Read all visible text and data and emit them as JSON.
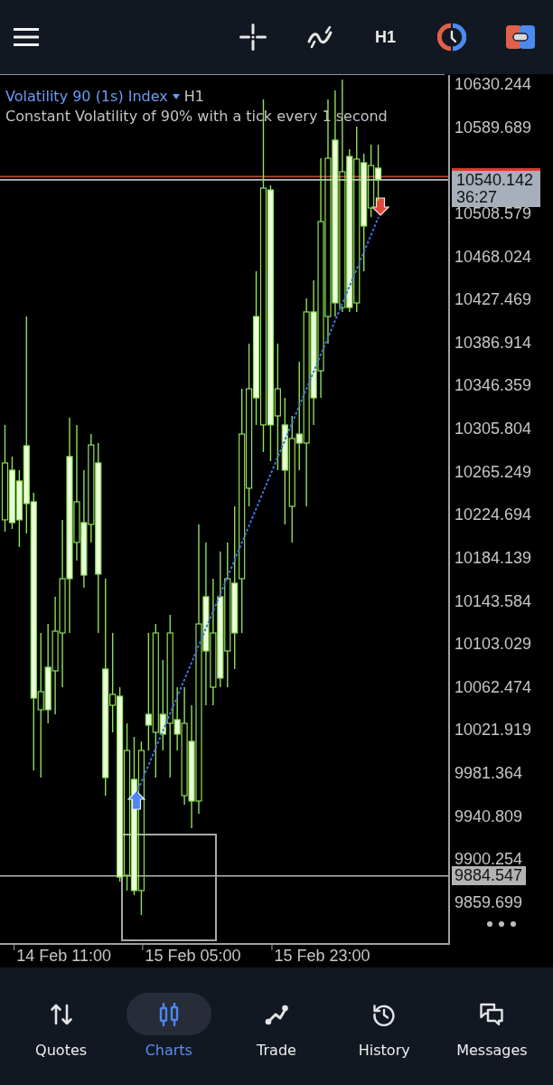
{
  "toolbar": {
    "timeframe": "H1"
  },
  "chart": {
    "symbol": "Volatility 90 (1s) Index",
    "timeframe": "H1",
    "description": "Constant Volatility of 90% with a tick every 1 second",
    "chart_data": {
      "type": "candlestick",
      "categories": [
        null,
        null,
        null,
        null,
        null,
        null,
        null,
        null,
        "14 Feb 11:00",
        null,
        null,
        null,
        null,
        null,
        null,
        null,
        null,
        null,
        null,
        null,
        null,
        null,
        null,
        null,
        null,
        null,
        "15 Feb 05:00",
        null,
        null,
        null,
        null,
        null,
        null,
        null,
        null,
        null,
        null,
        null,
        null,
        null,
        null,
        null,
        null,
        null,
        "15 Feb 23:00",
        null,
        null,
        null,
        null,
        null,
        null,
        null,
        null
      ],
      "ohlc": [
        [
          10219.9,
          10309.3,
          10208.8,
          10273.5
        ],
        [
          10266.7,
          10279.5,
          10211.3,
          10217.3
        ],
        [
          10256.5,
          10266.7,
          10194.3,
          10219.9
        ],
        [
          10289.7,
          10411.4,
          10207.1,
          10235.2
        ],
        [
          10236.9,
          10245.4,
          9984.0,
          10052.1
        ],
        [
          10041.1,
          10113.4,
          9977.2,
          10058.1
        ],
        [
          10081.1,
          10121.9,
          10028.3,
          10041.1
        ],
        [
          10077.7,
          10147.5,
          10036.8,
          10115.1
        ],
        [
          10113.4,
          10219.9,
          10062.3,
          10164.5
        ],
        [
          10279.5,
          10316.1,
          10113.4,
          10164.5
        ],
        [
          10198.6,
          10309.3,
          10181.5,
          10236.9
        ],
        [
          10217.3,
          10266.7,
          10156.0,
          10167.9
        ],
        [
          10215.6,
          10300.7,
          10198.6,
          10290.5
        ],
        [
          10273.5,
          10292.2,
          10113.4,
          10168.8
        ],
        [
          10079.4,
          10164.5,
          9960.2,
          9977.2
        ],
        [
          10045.3,
          10113.4,
          10019.8,
          10055.5
        ],
        [
          10053.8,
          10062.3,
          9879.3,
          9883.5
        ],
        [
          9885.2,
          10028.3,
          9870.8,
          10002.7
        ],
        [
          9975.5,
          10015.5,
          9866.5,
          9870.8
        ],
        [
          9870.8,
          10011.3,
          9847.8,
          10002.7
        ],
        [
          10036.8,
          10113.4,
          10002.7,
          10026.6
        ],
        [
          10019.8,
          10121.9,
          9977.2,
          10113.4
        ],
        [
          10036.8,
          10087.9,
          10002.7,
          10018.1
        ],
        [
          10028.3,
          10130.5,
          9977.2,
          10113.4
        ],
        [
          10031.7,
          10062.3,
          10002.7,
          10018.1
        ],
        [
          9960.2,
          10062.3,
          9951.7,
          10028.3
        ],
        [
          10011.3,
          10045.3,
          9929.5,
          9955.1
        ],
        [
          9955.1,
          10215.6,
          9943.1,
          10121.9
        ],
        [
          10147.5,
          10198.6,
          10045.3,
          10096.4
        ],
        [
          10062.3,
          10164.5,
          10045.3,
          10113.4
        ],
        [
          10147.5,
          10190.1,
          10062.3,
          10070.9
        ],
        [
          10096.4,
          10198.6,
          10062.3,
          10164.5
        ],
        [
          10160.3,
          10232.6,
          10079.4,
          10113.4
        ],
        [
          10164.5,
          10343.3,
          10113.4,
          10300.7
        ],
        [
          10249.7,
          10385.9,
          10232.6,
          10343.3
        ],
        [
          10411.4,
          10454.0,
          10309.3,
          10334.8
        ],
        [
          10309.3,
          10615.8,
          10283.7,
          10532.3
        ],
        [
          10530.6,
          10534.9,
          10275.2,
          10309.3
        ],
        [
          10317.8,
          10385.9,
          10266.7,
          10343.3
        ],
        [
          10309.3,
          10334.8,
          10215.6,
          10266.7
        ],
        [
          10232.6,
          10317.8,
          10198.6,
          10296.5
        ],
        [
          10300.7,
          10368.9,
          10266.7,
          10292.2
        ],
        [
          10292.2,
          10428.5,
          10232.6,
          10415.7
        ],
        [
          10415.7,
          10445.5,
          10309.3,
          10334.8
        ],
        [
          10360.3,
          10560.4,
          10334.8,
          10500.8
        ],
        [
          10411.4,
          10615.8,
          10385.9,
          10560.4
        ],
        [
          10577.5,
          10624.3,
          10411.4,
          10424.2
        ],
        [
          10419.9,
          10634.5,
          10415.7,
          10547.7
        ],
        [
          10562.1,
          10568.9,
          10415.7,
          10419.9
        ],
        [
          10424.2,
          10590.2,
          10415.7,
          10559.6
        ],
        [
          10556.2,
          10564.7,
          10454.0,
          10496.6
        ],
        [
          10513.6,
          10573.2,
          10505.1,
          10553.6
        ],
        [
          10551.1,
          10573.2,
          10520.4,
          10540.1
        ]
      ],
      "ylim": [
        9821.38,
        10638.76
      ],
      "yticks": [
        10630.244,
        10589.689,
        10508.579,
        10468.024,
        10427.469,
        10386.914,
        10346.359,
        10305.804,
        10265.249,
        10224.694,
        10184.139,
        10143.584,
        10103.029,
        10062.474,
        10021.919,
        9981.364,
        9940.809,
        9900.254,
        9859.699
      ],
      "ref_lines": [
        {
          "axis": "y",
          "value": 10543.1,
          "color": "#c0453a"
        },
        {
          "axis": "y",
          "value": 10540.142,
          "color": "#b7c0ca"
        },
        {
          "axis": "y",
          "value": 9884.547,
          "color": "#b4b4b4"
        }
      ]
    },
    "price_tag": {
      "price": "10540.142",
      "countdown": "36:27"
    },
    "line_tag": {
      "price": "9884.547"
    }
  },
  "bottom_nav": [
    {
      "label": "Quotes",
      "selected": false
    },
    {
      "label": "Charts",
      "selected": true
    },
    {
      "label": "Trade",
      "selected": false
    },
    {
      "label": "History",
      "selected": false
    },
    {
      "label": "Messages",
      "selected": false
    }
  ]
}
